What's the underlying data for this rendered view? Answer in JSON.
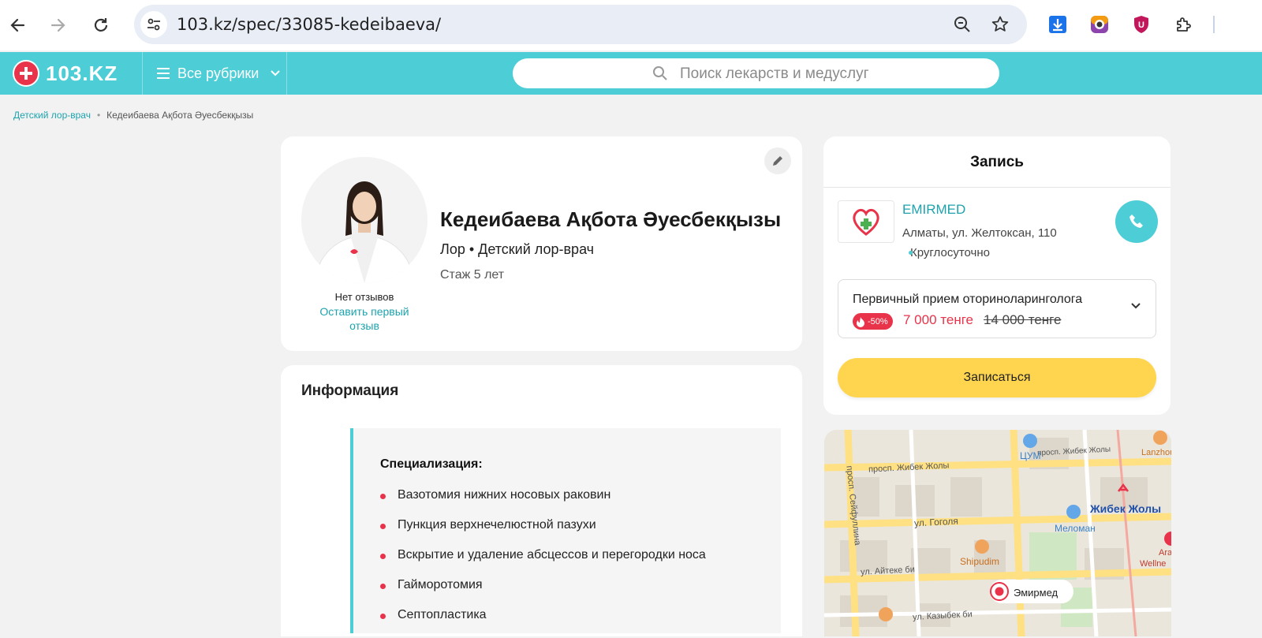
{
  "browser": {
    "url": "103.kz/spec/33085-kedeibaeva/"
  },
  "header": {
    "logo_text": "103.KZ",
    "rubrics_label": "Все рубрики",
    "search_placeholder": "Поиск лекарств и медуслуг"
  },
  "breadcrumb": {
    "items": [
      "Детский лор-врач",
      "Кедеибаева Ақбота Әуесбекқызы"
    ]
  },
  "doctor": {
    "name": "Кедеибаева Ақбота Әуесбекқызы",
    "specialty": "Лор • Детский лор-врач",
    "experience": "Стаж 5 лет",
    "reviews_status": "Нет отзывов",
    "leave_review": "Оставить первый отзыв"
  },
  "info": {
    "title": "Информация",
    "spec_heading": "Специализация:",
    "spec_items": [
      "Вазотомия нижних носовых раковин",
      "Пункция верхнечелюстной пазухи",
      "Вскрытие и удаление абсцессов и перегородки носа",
      "Гайморотомия",
      "Септопластика"
    ]
  },
  "booking": {
    "title": "Запись",
    "clinic_name": "EMIRMED",
    "clinic_address": "Алматы, ул. Желтоксан, 110",
    "clinic_hours": "Круглосуточно",
    "service_name": "Первичный прием оториноларинголога",
    "discount": "-50%",
    "price_new": "7 000 тенге",
    "price_old": "14 000 тенге",
    "book_button": "Записаться"
  },
  "map": {
    "labels": [
      "просп. Жибек Жолы",
      "просп. Жибек Жолы",
      "ЦУМ",
      "Lanzhou",
      "просп. Сейфуллина",
      "Жибек Жолы",
      "ул. Гоголя",
      "Меломан",
      "Shipudim",
      "ул. Айтеке би",
      "ул. Казыбек би",
      "Ara",
      "Wellne",
      "Эмирмед"
    ]
  },
  "colors": {
    "accent": "#4dcdd6",
    "brand_red": "#e8334a",
    "link": "#1ea3ad",
    "book_button": "#ffd54f"
  }
}
